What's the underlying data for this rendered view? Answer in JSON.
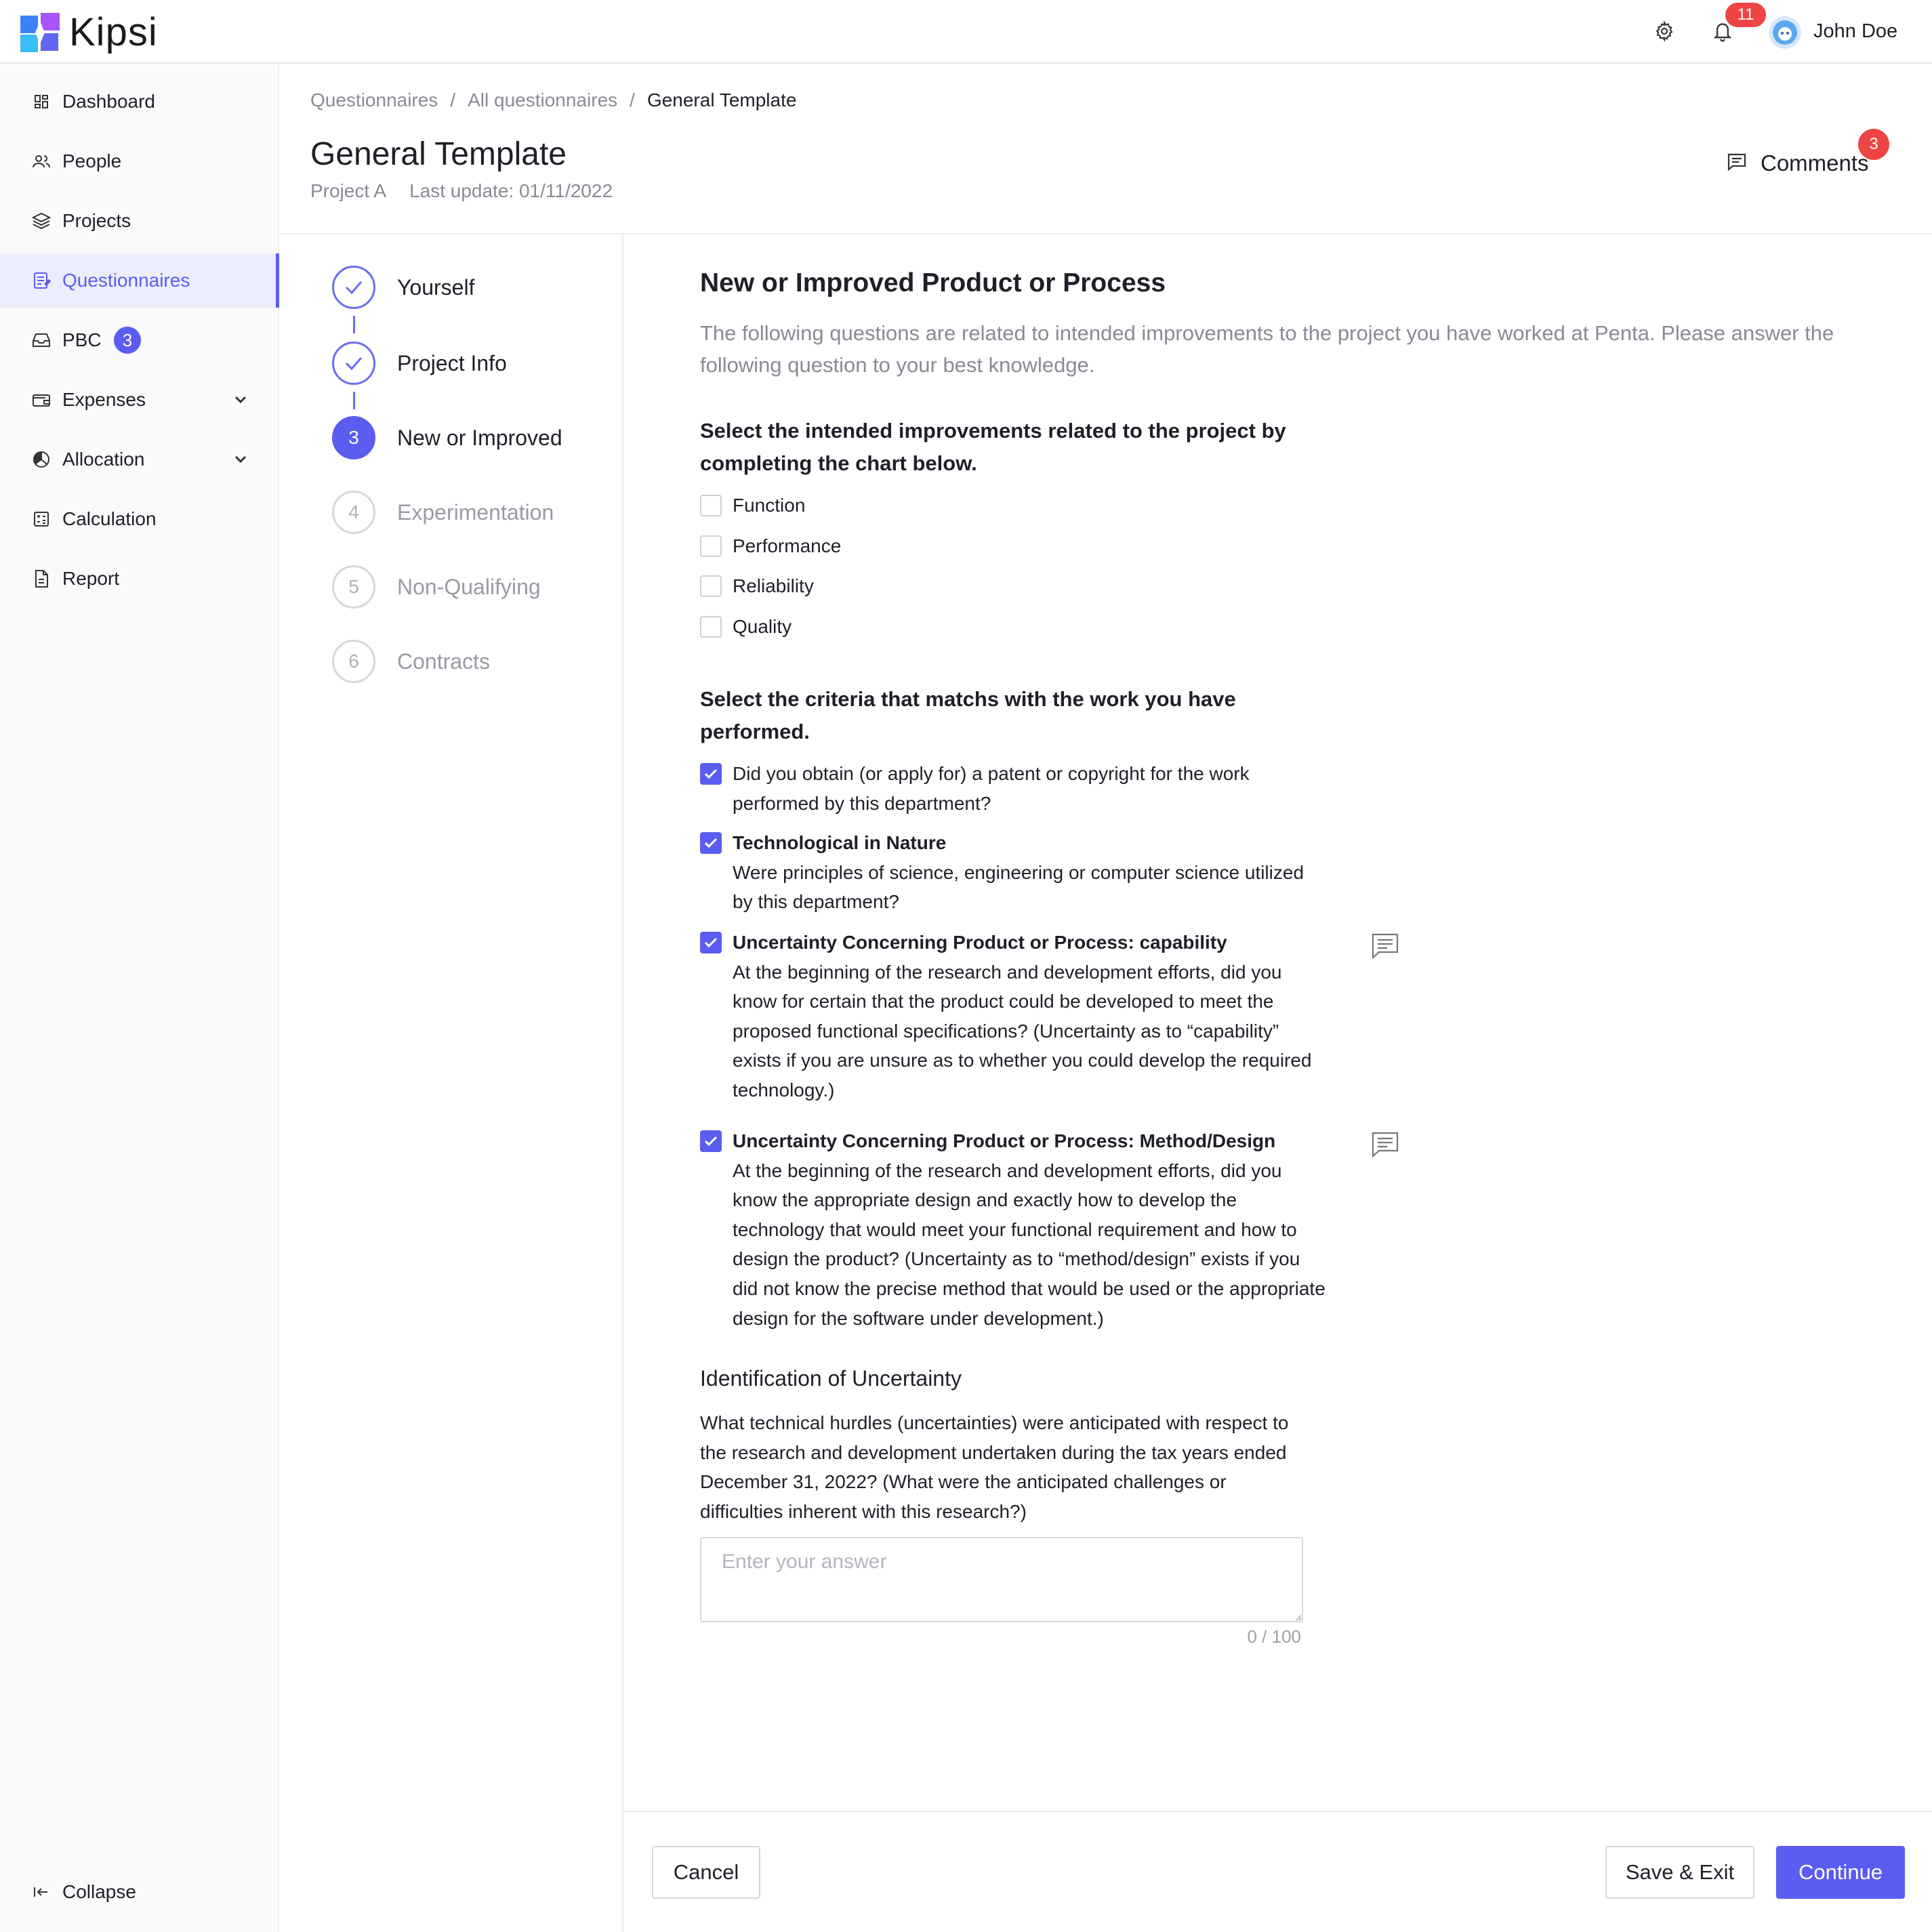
{
  "brand": {
    "name": "Kipsi"
  },
  "header": {
    "notifications_count": "11",
    "user_name": "John Doe"
  },
  "sidebar": {
    "items": [
      {
        "label": "Dashboard",
        "icon": "dashboard-icon"
      },
      {
        "label": "People",
        "icon": "people-icon"
      },
      {
        "label": "Projects",
        "icon": "layers-icon"
      },
      {
        "label": "Questionnaires",
        "icon": "questionnaire-icon",
        "active": true
      },
      {
        "label": "PBC",
        "icon": "inbox-icon",
        "badge": "3"
      },
      {
        "label": "Expenses",
        "icon": "wallet-icon",
        "expandable": true
      },
      {
        "label": "Allocation",
        "icon": "pie-icon",
        "expandable": true
      },
      {
        "label": "Calculation",
        "icon": "calculator-icon"
      },
      {
        "label": "Report",
        "icon": "document-icon"
      }
    ],
    "collapse_label": "Collapse"
  },
  "breadcrumb": [
    "Questionnaires",
    "All questionnaires",
    "General Template"
  ],
  "page": {
    "title": "General Template",
    "project": "Project A",
    "last_update": "Last update: 01/11/2022",
    "comments_label": "Comments",
    "comments_count": "3"
  },
  "steps": [
    {
      "number": "1",
      "label": "Yourself",
      "status": "done"
    },
    {
      "number": "2",
      "label": "Project Info",
      "status": "done"
    },
    {
      "number": "3",
      "label": "New or Improved",
      "status": "current"
    },
    {
      "number": "4",
      "label": "Experimentation",
      "status": "todo"
    },
    {
      "number": "5",
      "label": "Non-Qualifying",
      "status": "todo"
    },
    {
      "number": "6",
      "label": "Contracts",
      "status": "todo"
    }
  ],
  "section": {
    "title": "New or Improved Product or Process",
    "description": "The following questions are related to intended improvements to the project you have worked at Penta. Please answer the following question to your best knowledge."
  },
  "improvements": {
    "question": "Select the intended improvements related to the project by completing the chart below.",
    "options": [
      {
        "label": "Function",
        "checked": false
      },
      {
        "label": "Performance",
        "checked": false
      },
      {
        "label": "Reliability",
        "checked": false
      },
      {
        "label": "Quality",
        "checked": false
      }
    ]
  },
  "criteria": {
    "question": "Select the criteria that matchs with the work you have performed.",
    "items": [
      {
        "title": "",
        "text": "Did you obtain (or apply for) a patent or copyright for the work performed by this department?",
        "checked": true
      },
      {
        "title": "Technological in Nature",
        "text": "Were principles of science, engineering or computer science utilized by this department?",
        "checked": true
      },
      {
        "title": "Uncertainty Concerning Product or Process: capability",
        "text": "At the beginning of the research and development efforts, did you know for certain that the product could be developed to meet the proposed functional specifications? (Uncertainty as to “capability” exists if you are unsure as to whether you could develop the required technology.)",
        "checked": true
      },
      {
        "title": "Uncertainty Concerning Product or Process: Method/Design",
        "text": "At the beginning of the research and development efforts, did you know the appropriate design and exactly how to develop the technology that would meet your functional requirement and how to design the product? (Uncertainty as to “method/design” exists if you did not know the precise method that would be used or the appropriate design for the software under development.)",
        "checked": true
      }
    ]
  },
  "identification": {
    "title": "Identification of Uncertainty",
    "question": "What technical hurdles (uncertainties) were anticipated with respect to the research and development undertaken during the tax years ended December 31, 2022? (What were the anticipated challenges or difficulties inherent with this research?)",
    "answer_value": "",
    "placeholder": "Enter your answer",
    "char_count": "0 / 100"
  },
  "footer": {
    "cancel_label": "Cancel",
    "save_label": "Save & Exit",
    "continue_label": "Continue"
  },
  "colors": {
    "accent": "#5b5cf0",
    "badge_red": "#ef4444",
    "muted_text": "#8a8a96"
  }
}
